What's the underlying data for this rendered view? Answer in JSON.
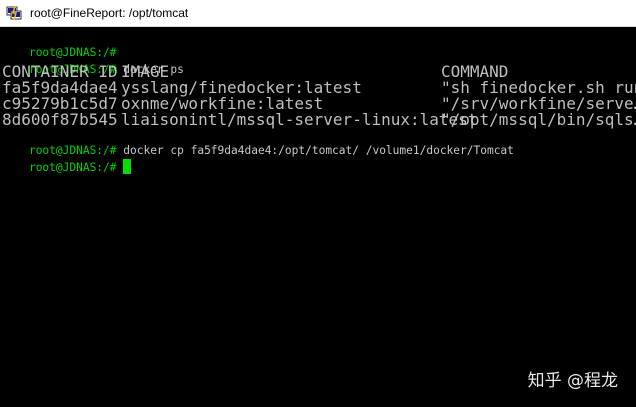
{
  "window": {
    "title": "root@FineReport: /opt/tomcat",
    "icon": "putty-terminal-icon"
  },
  "terminal": {
    "prompt": "root@JDNAS:/#",
    "lines": [
      {
        "prompt": "root@JDNAS:/#",
        "command": ""
      },
      {
        "prompt": "root@JDNAS:/#",
        "command": " docker ps"
      }
    ],
    "table": {
      "headers": [
        "CONTAINER ID",
        "IMAGE",
        "COMMAND"
      ],
      "rows": [
        [
          "fa5f9da4dae4",
          "ysslang/finedocker:latest",
          "\"sh finedocker.sh run\""
        ],
        [
          "c95279b1c5d7",
          "oxnme/workfine:latest",
          "\"/srv/workfine/serve…\""
        ],
        [
          "8d600f87b545",
          "liaisonintl/mssql-server-linux:latest",
          "\"/opt/mssql/bin/sqls…\""
        ]
      ]
    },
    "after": [
      {
        "prompt": "root@JDNAS:/#",
        "command": " docker cp fa5f9da4dae4:/opt/tomcat/ /volume1/docker/Tomcat"
      },
      {
        "prompt": "root@JDNAS:/#",
        "command": " "
      }
    ],
    "colors": {
      "prompt": "#00d200",
      "text": "#c8c8c8",
      "cursor": "#00e000",
      "background": "#000000"
    }
  },
  "watermark": {
    "text": "知乎 @程龙"
  }
}
